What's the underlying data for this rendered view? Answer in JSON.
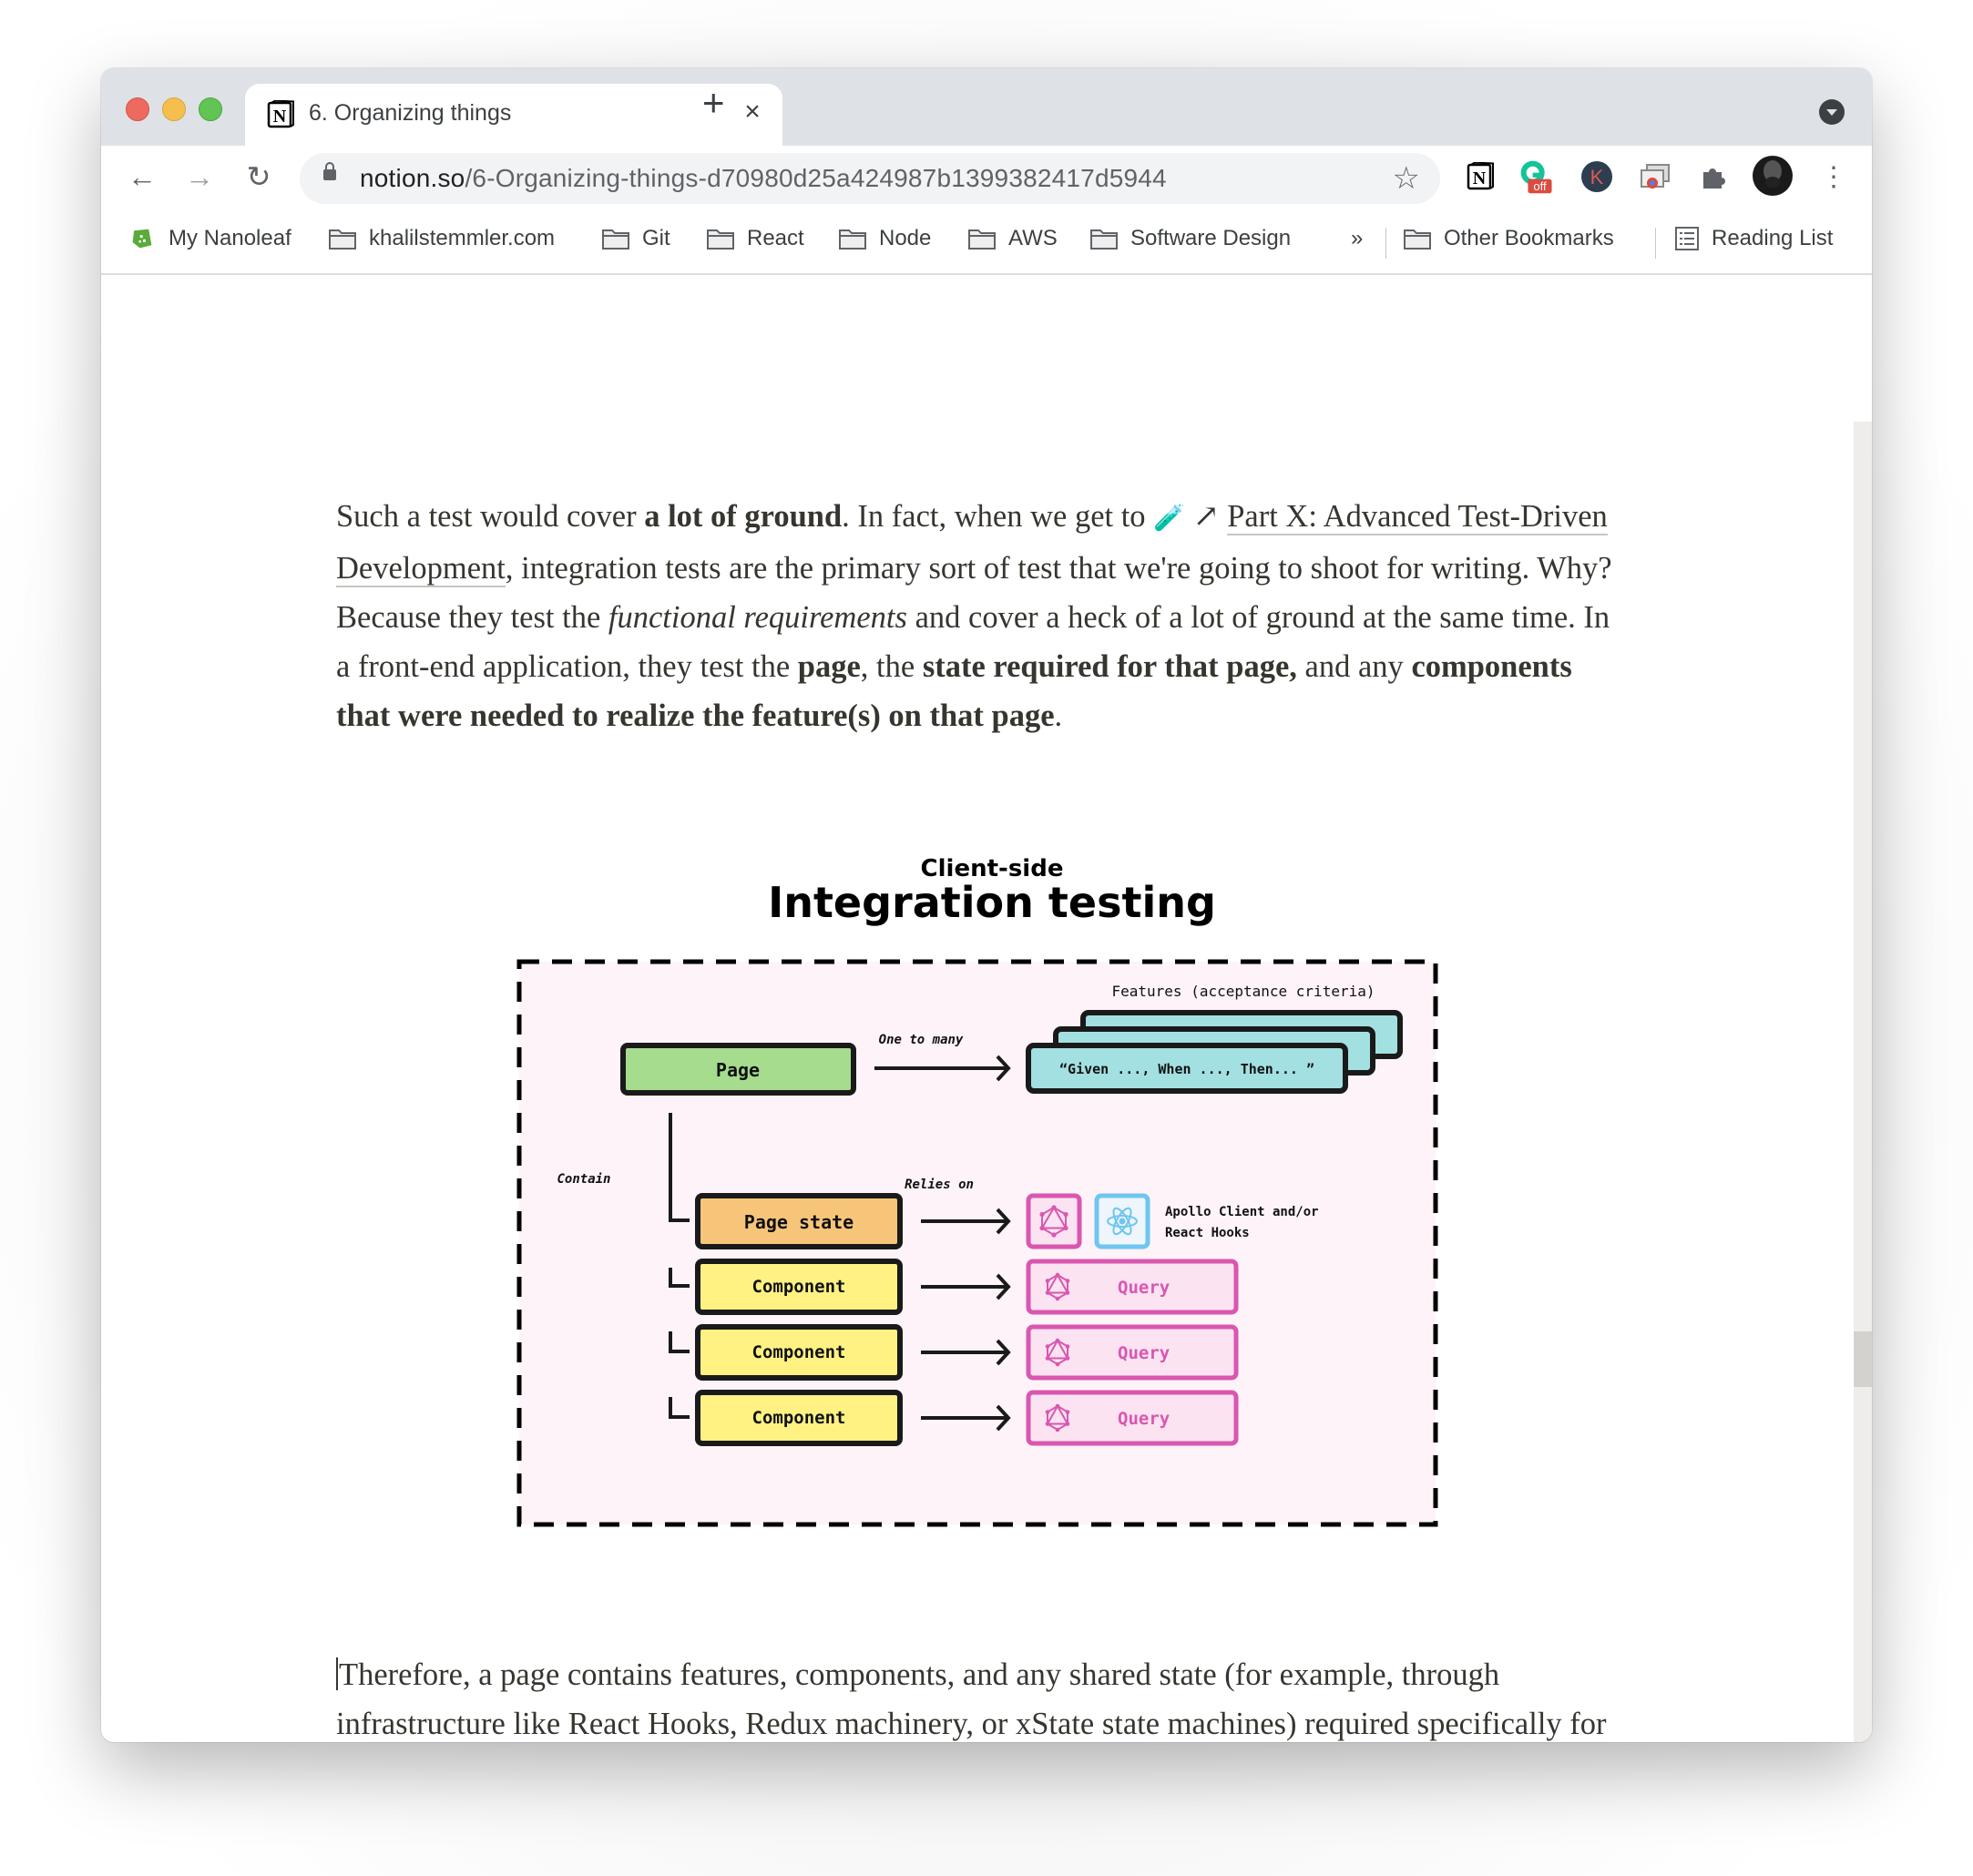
{
  "browser": {
    "tab": {
      "title": "6. Organizing things",
      "close_label": "×",
      "icon": "notion-icon"
    },
    "new_tab_label": "+",
    "url": {
      "host": "notion.so",
      "path": "/6-Organizing-things-d70980d25a424987b1399382417d5944"
    },
    "nav": {
      "back": "←",
      "forward": "→",
      "reload": "↻"
    },
    "extensions": [
      {
        "name": "notion-extension-icon",
        "label": "N"
      },
      {
        "name": "grammarly-extension-icon",
        "badge": "off"
      },
      {
        "name": "k-extension-icon",
        "label": "K"
      },
      {
        "name": "cast-extension-icon",
        "label": ""
      },
      {
        "name": "extensions-puzzle-icon",
        "label": ""
      },
      {
        "name": "profile-avatar",
        "label": ""
      },
      {
        "name": "menu-kebab-icon",
        "label": "⋮"
      }
    ],
    "bookmarks": [
      {
        "label": "My Nanoleaf",
        "icon": "nanoleaf-icon"
      },
      {
        "label": "khalilstemmler.com",
        "icon": "folder-icon"
      },
      {
        "label": "Git",
        "icon": "folder-icon"
      },
      {
        "label": "React",
        "icon": "folder-icon"
      },
      {
        "label": "Node",
        "icon": "folder-icon"
      },
      {
        "label": "AWS",
        "icon": "folder-icon"
      },
      {
        "label": "Software Design",
        "icon": "folder-icon"
      }
    ],
    "bookmarks_overflow": "»",
    "other_bookmarks": "Other Bookmarks",
    "reading_list": "Reading List"
  },
  "article": {
    "para1": {
      "s1": "Such a test would cover ",
      "b1": "a lot of ground",
      "s2": ". In fact, when we get to ",
      "emoji": "🧪",
      "arrow": "↗",
      "link": "Part X: Advanced Test-Driven Development",
      "s3": ", integration tests are the primary sort of test that we're going to shoot for writing. Why? Because they test the ",
      "i1": "functional requirements",
      "s4": " and cover a heck of a lot of ground at the same time. In a front-end application, they test the ",
      "b2": "page",
      "s5": ", the ",
      "b3": "state required for that page,",
      "s6": " and any ",
      "b4": "components that were needed to realize the feature(s) on that page",
      "s7": "."
    },
    "para2": "Therefore, a page contains features, components, and any shared state (for example, through infrastructure like React Hooks, Redux machinery, or xState state machines) required specifically for that page and the nested components."
  },
  "diagram": {
    "subtitle": "Client-side",
    "title": "Integration testing",
    "features_label": "Features (acceptance criteria)",
    "one_to_many": "One to many",
    "page": "Page",
    "feature_text": "“Given ..., When ..., Then... ”",
    "contain": "Contain",
    "relies_on": "Relies on",
    "page_state": "Page state",
    "state_tools_line1": "Apollo Client and/or",
    "state_tools_line2": "React Hooks",
    "components": [
      "Component",
      "Component",
      "Component"
    ],
    "queries": [
      "Query",
      "Query",
      "Query"
    ],
    "colors": {
      "page": "#a6dc8e",
      "feature": "#a3e0e2",
      "page_state": "#f7c57a",
      "component": "#fff283",
      "query_border": "#d957b0",
      "query_fill": "#fbe3f1",
      "react_border": "#6ec6f0",
      "react_fill": "#eef5fb",
      "background": "#fdf3f8"
    }
  }
}
